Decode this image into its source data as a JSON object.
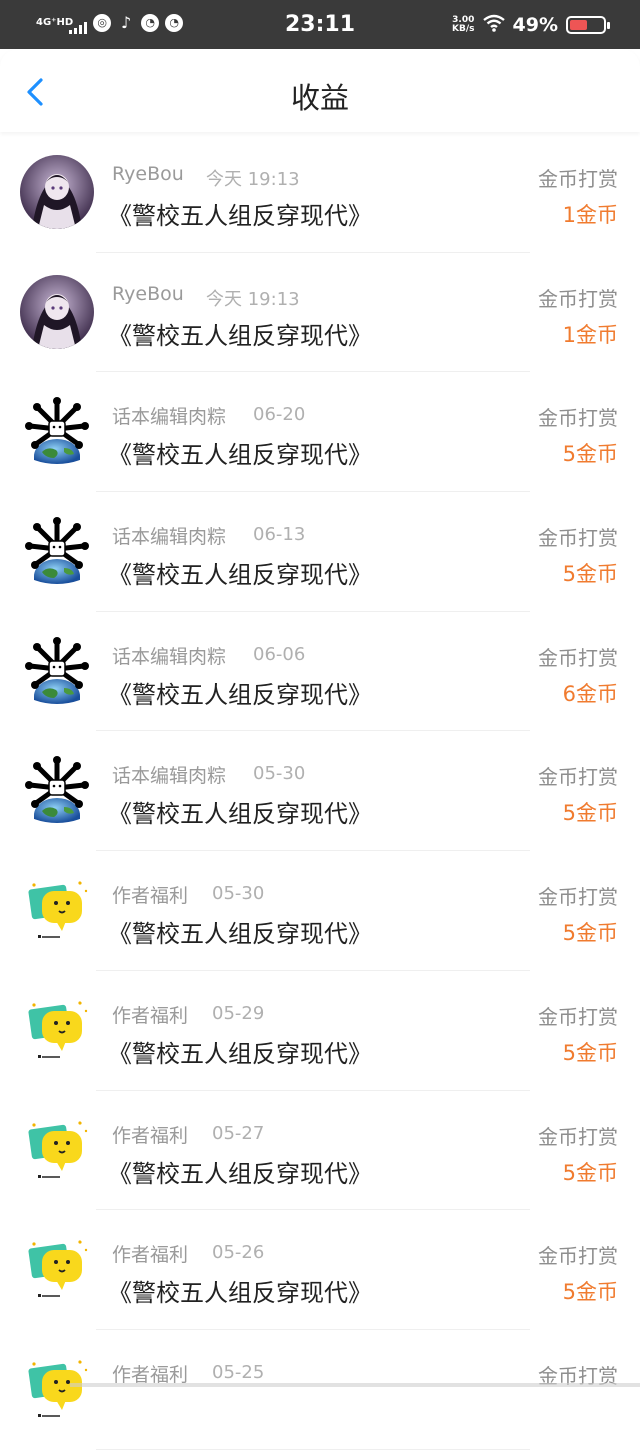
{
  "status_bar": {
    "network": "4G⁺HD",
    "time": "23:11",
    "speed_value": "3.00",
    "speed_unit": "KB/s",
    "battery": "49%",
    "icons": [
      "signal-icon",
      "app-icon",
      "tiktok-icon",
      "app-icon",
      "app-icon",
      "wifi-icon",
      "battery-icon"
    ]
  },
  "header": {
    "title": "收益"
  },
  "colors": {
    "accent": "#1e90ff",
    "amount": "#f07b2f"
  },
  "items": [
    {
      "name": "RyeBou",
      "date": "今天 19:13",
      "book": "《警校五人组反穿现代》",
      "type": "金币打赏",
      "amount": "1金币",
      "avatar": "anime"
    },
    {
      "name": "RyeBou",
      "date": "今天 19:13",
      "book": "《警校五人组反穿现代》",
      "type": "金币打赏",
      "amount": "1金币",
      "avatar": "anime"
    },
    {
      "name": "话本编辑肉粽",
      "date": "06-20",
      "book": "《警校五人组反穿现代》",
      "type": "金币打赏",
      "amount": "5金币",
      "avatar": "earth"
    },
    {
      "name": "话本编辑肉粽",
      "date": "06-13",
      "book": "《警校五人组反穿现代》",
      "type": "金币打赏",
      "amount": "5金币",
      "avatar": "earth"
    },
    {
      "name": "话本编辑肉粽",
      "date": "06-06",
      "book": "《警校五人组反穿现代》",
      "type": "金币打赏",
      "amount": "6金币",
      "avatar": "earth"
    },
    {
      "name": "话本编辑肉粽",
      "date": "05-30",
      "book": "《警校五人组反穿现代》",
      "type": "金币打赏",
      "amount": "5金币",
      "avatar": "earth"
    },
    {
      "name": "作者福利",
      "date": "05-30",
      "book": "《警校五人组反穿现代》",
      "type": "金币打赏",
      "amount": "5金币",
      "avatar": "chat"
    },
    {
      "name": "作者福利",
      "date": "05-29",
      "book": "《警校五人组反穿现代》",
      "type": "金币打赏",
      "amount": "5金币",
      "avatar": "chat"
    },
    {
      "name": "作者福利",
      "date": "05-27",
      "book": "《警校五人组反穿现代》",
      "type": "金币打赏",
      "amount": "5金币",
      "avatar": "chat"
    },
    {
      "name": "作者福利",
      "date": "05-26",
      "book": "《警校五人组反穿现代》",
      "type": "金币打赏",
      "amount": "5金币",
      "avatar": "chat"
    },
    {
      "name": "作者福利",
      "date": "05-25",
      "book": "",
      "type": "金币打赏",
      "amount": "",
      "avatar": "chat"
    }
  ]
}
